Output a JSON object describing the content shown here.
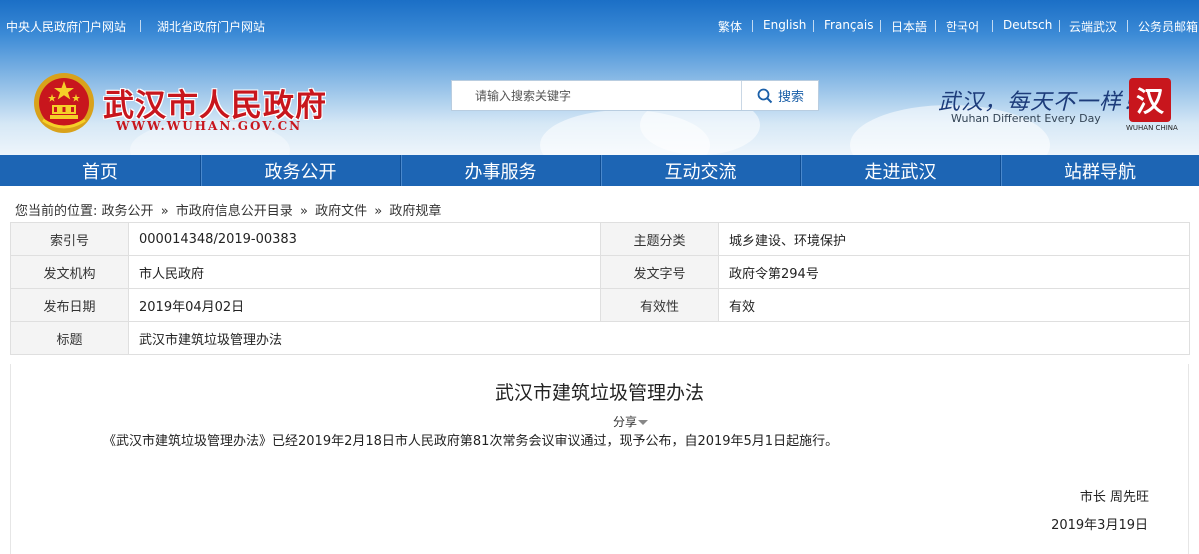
{
  "topbar": {
    "left_links": [
      "中央人民政府门户网站",
      "湖北省政府门户网站"
    ],
    "right_links": [
      "繁体",
      "English",
      "Français",
      "日本語",
      "한국어",
      "Deutsch",
      "云端武汉",
      "公务员邮箱"
    ]
  },
  "brand": {
    "name": "武汉市人民政府",
    "url": "WWW.WUHAN.GOV.CN",
    "slogan_cn": "武汉，每天不一样！",
    "slogan_en": "Wuhan  Different Every Day",
    "logo_char": "汉",
    "logo_text": "WUHAN CHINA",
    "colors": {
      "brand_red": "#c8161d",
      "nav_blue": "#1d65b4"
    }
  },
  "search": {
    "placeholder": "请输入搜索关键字",
    "button_label": "搜索"
  },
  "nav": {
    "items": [
      "首页",
      "政务公开",
      "办事服务",
      "互动交流",
      "走进武汉",
      "站群导航"
    ]
  },
  "breadcrumb": {
    "prefix": "您当前的位置:",
    "items": [
      "政务公开",
      "市政府信息公开目录",
      "政府文件",
      "政府规章"
    ],
    "separator": "»"
  },
  "info": {
    "index_label": "索引号",
    "index_value": "000014348/2019-00383",
    "topic_label": "主题分类",
    "topic_value": "城乡建设、环境保护",
    "issuer_label": "发文机构",
    "issuer_value": "市人民政府",
    "docno_label": "发文字号",
    "docno_value": "政府令第294号",
    "date_label": "发布日期",
    "date_value": "2019年04月02日",
    "validity_label": "有效性",
    "validity_value": "有效",
    "title_label": "标题",
    "title_value": "武汉市建筑垃圾管理办法"
  },
  "document": {
    "title": "武汉市建筑垃圾管理办法",
    "share_label": "分享",
    "body": "《武汉市建筑垃圾管理办法》已经2019年2月18日市人民政府第81次常务会议审议通过，现予公布，自2019年5月1日起施行。",
    "signer": "市长  周先旺",
    "sign_date": "2019年3月19日"
  }
}
